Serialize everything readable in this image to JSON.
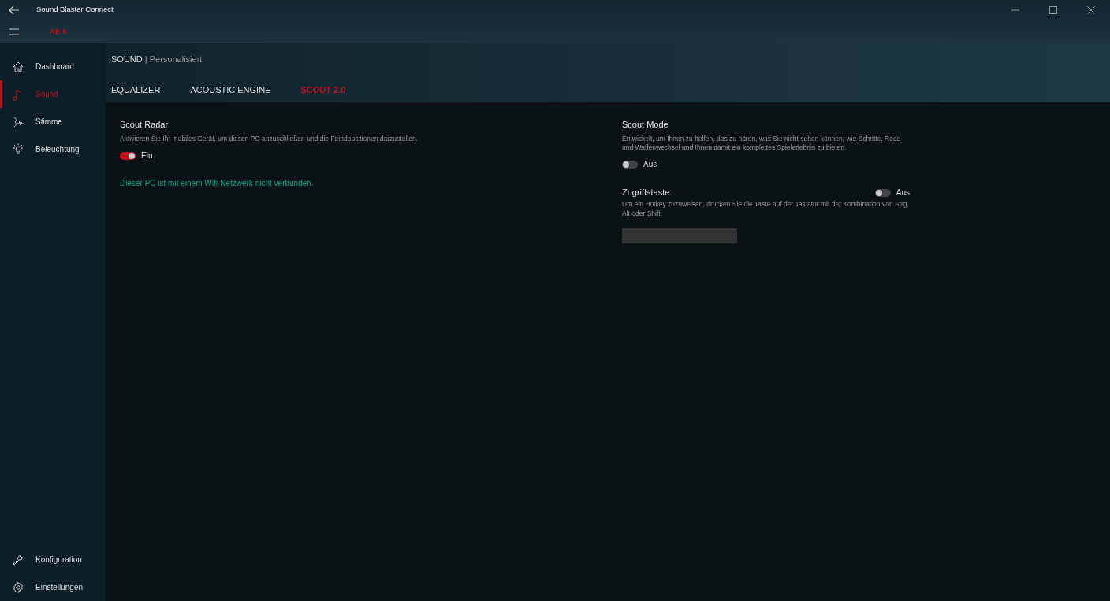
{
  "window": {
    "title": "Sound Blaster Connect"
  },
  "device": "AE-5",
  "sidebar": {
    "items": [
      {
        "label": "Dashboard",
        "selected": false
      },
      {
        "label": "Sound",
        "selected": true
      },
      {
        "label": "Stimme",
        "selected": false
      },
      {
        "label": "Beleuchtung",
        "selected": false
      }
    ],
    "bottom_items": [
      {
        "label": "Konfiguration"
      },
      {
        "label": "Einstellungen"
      }
    ]
  },
  "breadcrumb": {
    "section": "SOUND",
    "separator": "|",
    "profile": "Personalisiert"
  },
  "tabs": [
    {
      "label": "EQUALIZER",
      "selected": false
    },
    {
      "label": "ACOUSTIC ENGINE",
      "selected": false
    },
    {
      "label": "SCOUT 2.0",
      "selected": true
    }
  ],
  "scout_radar": {
    "title": "Scout Radar",
    "description": "Aktivieren Sie Ihr mobiles Gerät, um diesen PC anzuschließen und die Feindpositionen darzustellen.",
    "toggle": {
      "on": true,
      "label": "Ein"
    },
    "status": "Dieser PC ist mit einem Wifi-Netzwerk nicht verbunden."
  },
  "scout_mode": {
    "title": "Scout Mode",
    "description": "Entwickelt, um Ihnen zu helfen, das zu hören, was Sie nicht sehen können, wie Schritte, Rede und Waffenwechsel und Ihnen damit ein komplettes Spielerlebnis zu bieten.",
    "toggle": {
      "on": false,
      "label": "Aus"
    }
  },
  "hotkey": {
    "title": "Zugriffstaste",
    "description": "Um ein Hotkey zuzuweisen, drücken Sie die Taste auf der Tastatur mit der Kombination von Strg, Alt oder Shift.",
    "toggle": {
      "on": false,
      "label": "Aus"
    }
  }
}
